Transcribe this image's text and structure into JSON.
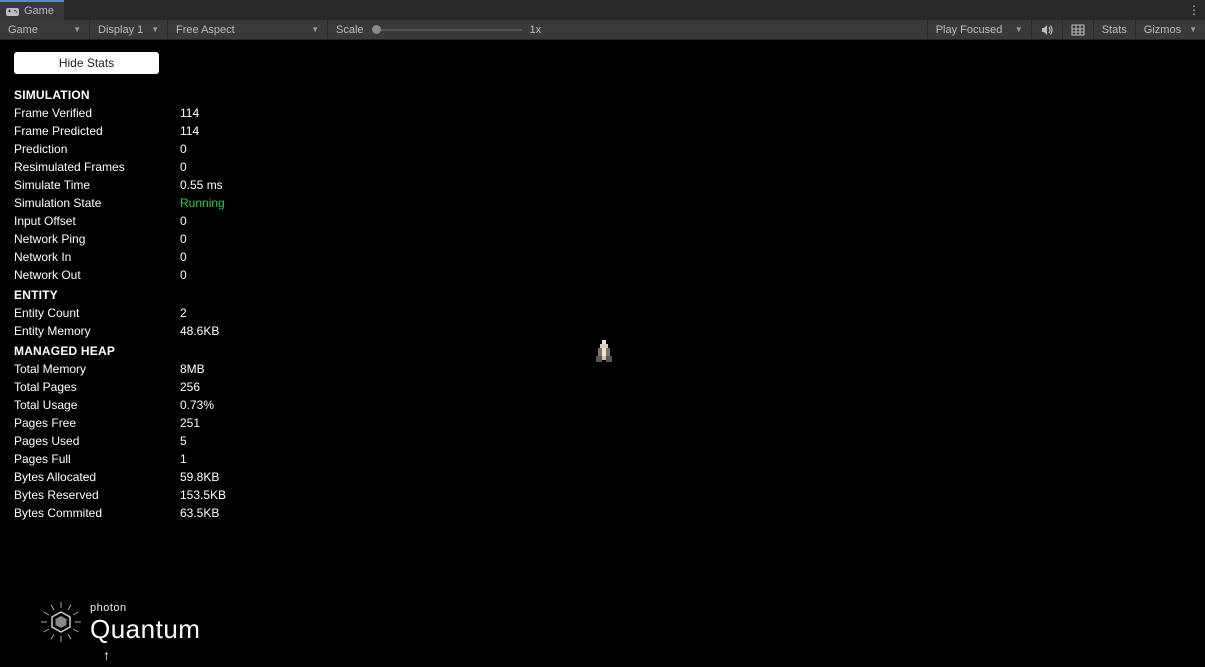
{
  "tab": {
    "title": "Game"
  },
  "toolbar": {
    "mode": "Game",
    "display": "Display 1",
    "aspect": "Free Aspect",
    "scale_label": "Scale",
    "scale_value": "1x",
    "play_mode": "Play Focused",
    "stats": "Stats",
    "gizmos": "Gizmos"
  },
  "button": {
    "hide_stats": "Hide Stats"
  },
  "sections": {
    "simulation": {
      "title": "SIMULATION",
      "rows": [
        {
          "label": "Frame Verified",
          "value": "114"
        },
        {
          "label": "Frame Predicted",
          "value": "114"
        },
        {
          "label": "Prediction",
          "value": "0"
        },
        {
          "label": "Resimulated Frames",
          "value": "0"
        },
        {
          "label": "Simulate Time",
          "value": "0.55 ms"
        },
        {
          "label": "Simulation State",
          "value": "Running",
          "cls": "running"
        },
        {
          "label": "Input Offset",
          "value": "0"
        },
        {
          "label": "Network Ping",
          "value": "0"
        },
        {
          "label": "Network In",
          "value": "0"
        },
        {
          "label": "Network Out",
          "value": "0"
        }
      ]
    },
    "entity": {
      "title": "ENTITY",
      "rows": [
        {
          "label": "Entity Count",
          "value": "2"
        },
        {
          "label": "Entity Memory",
          "value": "48.6KB"
        }
      ]
    },
    "heap": {
      "title": "MANAGED HEAP",
      "rows": [
        {
          "label": "Total Memory",
          "value": "8MB"
        },
        {
          "label": "Total Pages",
          "value": "256"
        },
        {
          "label": "Total Usage",
          "value": "0.73%"
        },
        {
          "label": "Pages Free",
          "value": "251"
        },
        {
          "label": "Pages Used",
          "value": "5"
        },
        {
          "label": "Pages Full",
          "value": "1"
        },
        {
          "label": "Bytes Allocated",
          "value": "59.8KB"
        },
        {
          "label": "Bytes Reserved",
          "value": "153.5KB"
        },
        {
          "label": "Bytes Commited",
          "value": "63.5KB"
        }
      ]
    }
  },
  "logo": {
    "small": "photon",
    "big": "Quantum"
  }
}
